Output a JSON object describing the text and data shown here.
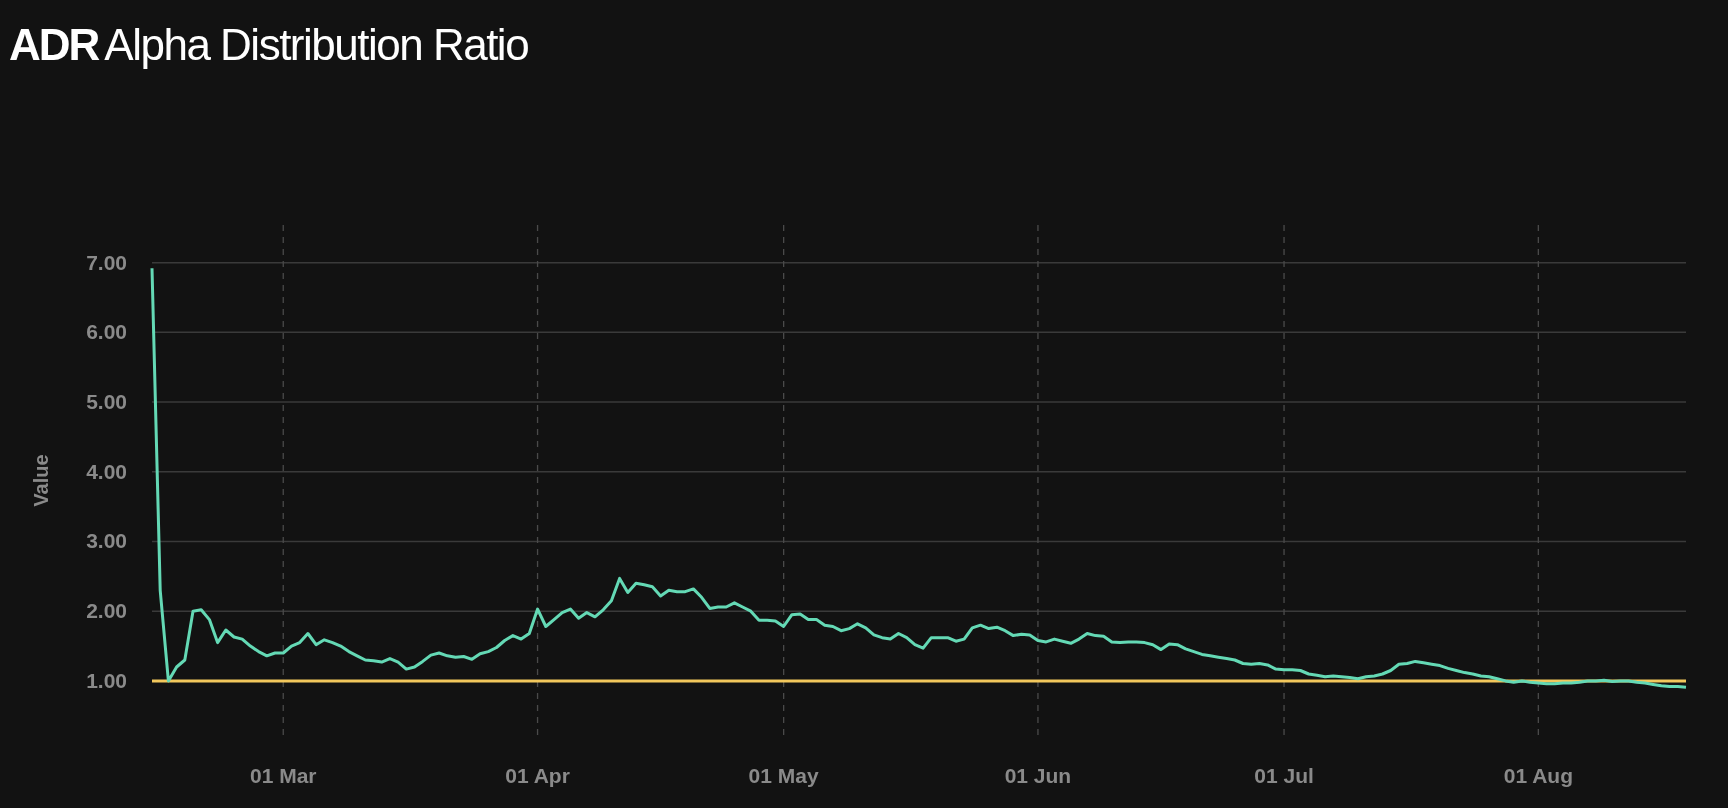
{
  "header": {
    "code": "ADR",
    "title": "Alpha Distribution Ratio"
  },
  "chart_data": {
    "type": "line",
    "ylabel": "Value",
    "categories": [
      null,
      null,
      null,
      null,
      null,
      null,
      null,
      null,
      null,
      null,
      null,
      null,
      null,
      null,
      null,
      null,
      "01 Mar",
      null,
      null,
      null,
      null,
      null,
      null,
      null,
      null,
      null,
      null,
      null,
      null,
      null,
      null,
      null,
      null,
      null,
      null,
      null,
      null,
      null,
      null,
      null,
      null,
      null,
      null,
      null,
      null,
      null,
      null,
      "01 Apr",
      null,
      null,
      null,
      null,
      null,
      null,
      null,
      null,
      null,
      null,
      null,
      null,
      null,
      null,
      null,
      null,
      null,
      null,
      null,
      null,
      null,
      null,
      null,
      null,
      null,
      null,
      null,
      null,
      null,
      "01 May",
      null,
      null,
      null,
      null,
      null,
      null,
      null,
      null,
      null,
      null,
      null,
      null,
      null,
      null,
      null,
      null,
      null,
      null,
      null,
      null,
      null,
      null,
      null,
      null,
      null,
      null,
      null,
      null,
      null,
      null,
      "01 Jun",
      null,
      null,
      null,
      null,
      null,
      null,
      null,
      null,
      null,
      null,
      null,
      null,
      null,
      null,
      null,
      null,
      null,
      null,
      null,
      null,
      null,
      null,
      null,
      null,
      null,
      null,
      null,
      null,
      null,
      "01 Jul",
      null,
      null,
      null,
      null,
      null,
      null,
      null,
      null,
      null,
      null,
      null,
      null,
      null,
      null,
      null,
      null,
      null,
      null,
      null,
      null,
      null,
      null,
      null,
      null,
      null,
      null,
      null,
      null,
      null,
      null,
      "01 Aug",
      null,
      null,
      null,
      null,
      null,
      null,
      null,
      null,
      null,
      null,
      null,
      null,
      null,
      null,
      null,
      null,
      null,
      null
    ],
    "series": [
      {
        "color": "#64d9b5",
        "values": [
          6.92,
          2.3,
          1.0,
          1.2,
          1.3,
          2.0,
          2.02,
          1.88,
          1.55,
          1.73,
          1.63,
          1.6,
          1.5,
          1.42,
          1.36,
          1.4,
          1.4,
          1.5,
          1.55,
          1.68,
          1.52,
          1.59,
          1.55,
          1.5,
          1.42,
          1.36,
          1.3,
          1.29,
          1.27,
          1.32,
          1.27,
          1.17,
          1.2,
          1.28,
          1.37,
          1.4,
          1.36,
          1.34,
          1.35,
          1.31,
          1.39,
          1.42,
          1.48,
          1.58,
          1.65,
          1.6,
          1.68,
          2.03,
          1.78,
          1.88,
          1.98,
          2.03,
          1.9,
          1.98,
          1.92,
          2.02,
          2.15,
          2.47,
          2.27,
          2.4,
          2.38,
          2.35,
          2.22,
          2.3,
          2.28,
          2.28,
          2.32,
          2.2,
          2.04,
          2.06,
          2.06,
          2.12,
          2.06,
          2.0,
          1.87,
          1.87,
          1.86,
          1.78,
          1.95,
          1.96,
          1.88,
          1.88,
          1.8,
          1.78,
          1.72,
          1.75,
          1.82,
          1.76,
          1.66,
          1.62,
          1.6,
          1.68,
          1.62,
          1.52,
          1.47,
          1.62,
          1.62,
          1.62,
          1.57,
          1.6,
          1.76,
          1.8,
          1.75,
          1.77,
          1.72,
          1.65,
          1.67,
          1.66,
          1.58,
          1.56,
          1.6,
          1.57,
          1.54,
          1.6,
          1.68,
          1.65,
          1.64,
          1.56,
          1.55,
          1.56,
          1.56,
          1.55,
          1.52,
          1.45,
          1.53,
          1.52,
          1.46,
          1.42,
          1.38,
          1.36,
          1.34,
          1.32,
          1.3,
          1.25,
          1.24,
          1.25,
          1.23,
          1.17,
          1.16,
          1.16,
          1.15,
          1.1,
          1.08,
          1.06,
          1.07,
          1.06,
          1.05,
          1.03,
          1.06,
          1.07,
          1.1,
          1.15,
          1.24,
          1.25,
          1.28,
          1.26,
          1.24,
          1.22,
          1.18,
          1.15,
          1.12,
          1.1,
          1.07,
          1.06,
          1.03,
          1.0,
          0.98,
          1.0,
          0.98,
          0.97,
          0.96,
          0.96,
          0.97,
          0.97,
          0.98,
          1.0,
          1.0,
          1.01,
          0.99,
          1.0,
          1.0,
          0.98,
          0.97,
          0.95,
          0.93,
          0.92,
          0.92,
          0.91
        ]
      }
    ],
    "ylim": [
      0.21,
      7.54
    ],
    "yticks": [
      {
        "value": 1,
        "label": "1.00"
      },
      {
        "value": 2,
        "label": "2.00"
      },
      {
        "value": 3,
        "label": "3.00"
      },
      {
        "value": 4,
        "label": "4.00"
      },
      {
        "value": 5,
        "label": "5.00"
      },
      {
        "value": 6,
        "label": "6.00"
      },
      {
        "value": 7,
        "label": "7.00"
      }
    ],
    "grid": true,
    "ref_lines": [
      {
        "axis": "y",
        "value": 1,
        "color": "#f2c75c"
      }
    ]
  }
}
